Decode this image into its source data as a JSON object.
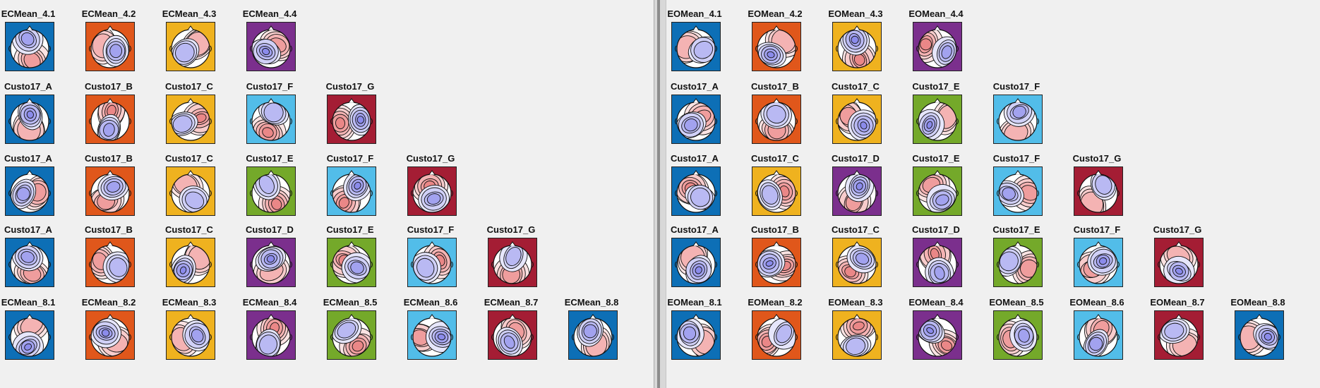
{
  "colors": {
    "blue": "#0d6fb6",
    "orange": "#e0571b",
    "yellow": "#efb21f",
    "purple": "#7b2f8d",
    "cyan": "#52bde9",
    "red": "#a41d34",
    "green": "#74a92a"
  },
  "panels": [
    {
      "name": "left",
      "rows": [
        {
          "maps": [
            {
              "label": "ECMean_4.1",
              "color": "blue",
              "seed": 3
            },
            {
              "label": "ECMean_4.2",
              "color": "orange",
              "seed": 7
            },
            {
              "label": "ECMean_4.3",
              "color": "yellow",
              "seed": 11
            },
            {
              "label": "ECMean_4.4",
              "color": "purple",
              "seed": 17
            }
          ]
        },
        {
          "maps": [
            {
              "label": "Custo17_A",
              "color": "blue",
              "seed": 21
            },
            {
              "label": "Custo17_B",
              "color": "orange",
              "seed": 24
            },
            {
              "label": "Custo17_C",
              "color": "yellow",
              "seed": 29
            },
            {
              "label": "Custo17_F",
              "color": "cyan",
              "seed": 33
            },
            {
              "label": "Custo17_G",
              "color": "red",
              "seed": 38
            }
          ]
        },
        {
          "maps": [
            {
              "label": "Custo17_A",
              "color": "blue",
              "seed": 41
            },
            {
              "label": "Custo17_B",
              "color": "orange",
              "seed": 45
            },
            {
              "label": "Custo17_C",
              "color": "yellow",
              "seed": 49
            },
            {
              "label": "Custo17_E",
              "color": "green",
              "seed": 52
            },
            {
              "label": "Custo17_F",
              "color": "cyan",
              "seed": 57
            },
            {
              "label": "Custo17_G",
              "color": "red",
              "seed": 61
            }
          ]
        },
        {
          "maps": [
            {
              "label": "Custo17_A",
              "color": "blue",
              "seed": 64
            },
            {
              "label": "Custo17_B",
              "color": "orange",
              "seed": 68
            },
            {
              "label": "Custo17_C",
              "color": "yellow",
              "seed": 72
            },
            {
              "label": "Custo17_D",
              "color": "purple",
              "seed": 76
            },
            {
              "label": "Custo17_E",
              "color": "green",
              "seed": 80
            },
            {
              "label": "Custo17_F",
              "color": "cyan",
              "seed": 84
            },
            {
              "label": "Custo17_G",
              "color": "red",
              "seed": 88
            }
          ]
        },
        {
          "maps": [
            {
              "label": "ECMean_8.1",
              "color": "blue",
              "seed": 91
            },
            {
              "label": "ECMean_8.2",
              "color": "orange",
              "seed": 95
            },
            {
              "label": "ECMean_8.3",
              "color": "yellow",
              "seed": 99
            },
            {
              "label": "ECMean_8.4",
              "color": "purple",
              "seed": 103
            },
            {
              "label": "ECMean_8.5",
              "color": "green",
              "seed": 107
            },
            {
              "label": "ECMean_8.6",
              "color": "cyan",
              "seed": 111
            },
            {
              "label": "ECMean_8.7",
              "color": "red",
              "seed": 115
            },
            {
              "label": "ECMean_8.8",
              "color": "blue",
              "seed": 119
            }
          ]
        }
      ]
    },
    {
      "name": "right",
      "rows": [
        {
          "maps": [
            {
              "label": "EOMean_4.1",
              "color": "blue",
              "seed": 123
            },
            {
              "label": "EOMean_4.2",
              "color": "orange",
              "seed": 127
            },
            {
              "label": "EOMean_4.3",
              "color": "yellow",
              "seed": 131
            },
            {
              "label": "EOMean_4.4",
              "color": "purple",
              "seed": 135
            }
          ]
        },
        {
          "maps": [
            {
              "label": "Custo17_A",
              "color": "blue",
              "seed": 139
            },
            {
              "label": "Custo17_B",
              "color": "orange",
              "seed": 143
            },
            {
              "label": "Custo17_C",
              "color": "yellow",
              "seed": 147
            },
            {
              "label": "Custo17_E",
              "color": "green",
              "seed": 151
            },
            {
              "label": "Custo17_F",
              "color": "cyan",
              "seed": 155
            }
          ]
        },
        {
          "maps": [
            {
              "label": "Custo17_A",
              "color": "blue",
              "seed": 159
            },
            {
              "label": "Custo17_C",
              "color": "yellow",
              "seed": 163
            },
            {
              "label": "Custo17_D",
              "color": "purple",
              "seed": 167
            },
            {
              "label": "Custo17_E",
              "color": "green",
              "seed": 171
            },
            {
              "label": "Custo17_F",
              "color": "cyan",
              "seed": 175
            },
            {
              "label": "Custo17_G",
              "color": "red",
              "seed": 179
            }
          ]
        },
        {
          "maps": [
            {
              "label": "Custo17_A",
              "color": "blue",
              "seed": 183
            },
            {
              "label": "Custo17_B",
              "color": "orange",
              "seed": 187
            },
            {
              "label": "Custo17_C",
              "color": "yellow",
              "seed": 191
            },
            {
              "label": "Custo17_D",
              "color": "purple",
              "seed": 195
            },
            {
              "label": "Custo17_E",
              "color": "green",
              "seed": 199
            },
            {
              "label": "Custo17_F",
              "color": "cyan",
              "seed": 203
            },
            {
              "label": "Custo17_G",
              "color": "red",
              "seed": 207
            }
          ]
        },
        {
          "maps": [
            {
              "label": "EOMean_8.1",
              "color": "blue",
              "seed": 211
            },
            {
              "label": "EOMean_8.2",
              "color": "orange",
              "seed": 215
            },
            {
              "label": "EOMean_8.3",
              "color": "yellow",
              "seed": 219
            },
            {
              "label": "EOMean_8.4",
              "color": "purple",
              "seed": 223
            },
            {
              "label": "EOMean_8.5",
              "color": "green",
              "seed": 227
            },
            {
              "label": "EOMean_8.6",
              "color": "cyan",
              "seed": 231
            },
            {
              "label": "EOMean_8.7",
              "color": "red",
              "seed": 235
            },
            {
              "label": "EOMean_8.8",
              "color": "blue",
              "seed": 239
            }
          ]
        }
      ]
    }
  ]
}
